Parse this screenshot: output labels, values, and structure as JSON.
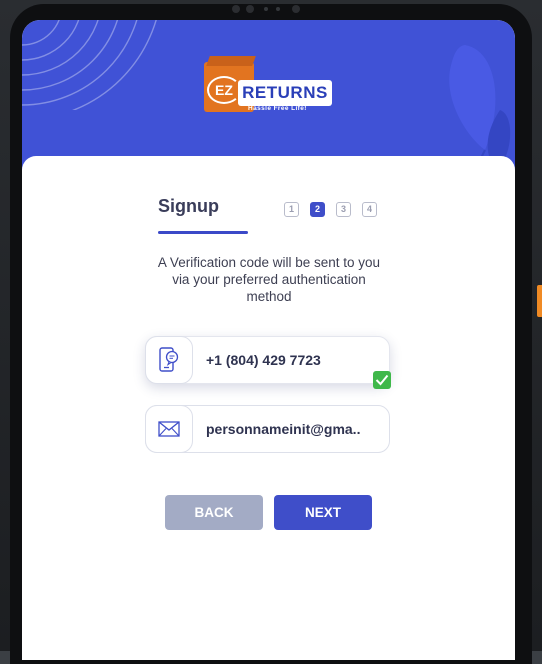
{
  "app": {
    "logo_badge": "EZ",
    "logo_name": "RETURNS",
    "logo_tagline": "Hassle Free Life!"
  },
  "signup": {
    "title": "Signup",
    "steps": [
      "1",
      "2",
      "3",
      "4"
    ],
    "active_step": 2,
    "description": "A Verification code will be sent to you via your preferred authentication method"
  },
  "methods": {
    "phone": {
      "value": "+1 (804) 429 7723",
      "icon": "phone-message-icon",
      "selected": true
    },
    "email": {
      "value": "personnameinit@gma..",
      "icon": "mail-icon",
      "selected": false
    }
  },
  "actions": {
    "back_label": "BACK",
    "next_label": "NEXT"
  },
  "colors": {
    "header_bg": "#4052d6",
    "primary": "#3f4ec9",
    "back_button": "#a3abc5",
    "check": "#3fb84a",
    "logo_orange": "#e27420",
    "side_accent": "#f08a24"
  }
}
